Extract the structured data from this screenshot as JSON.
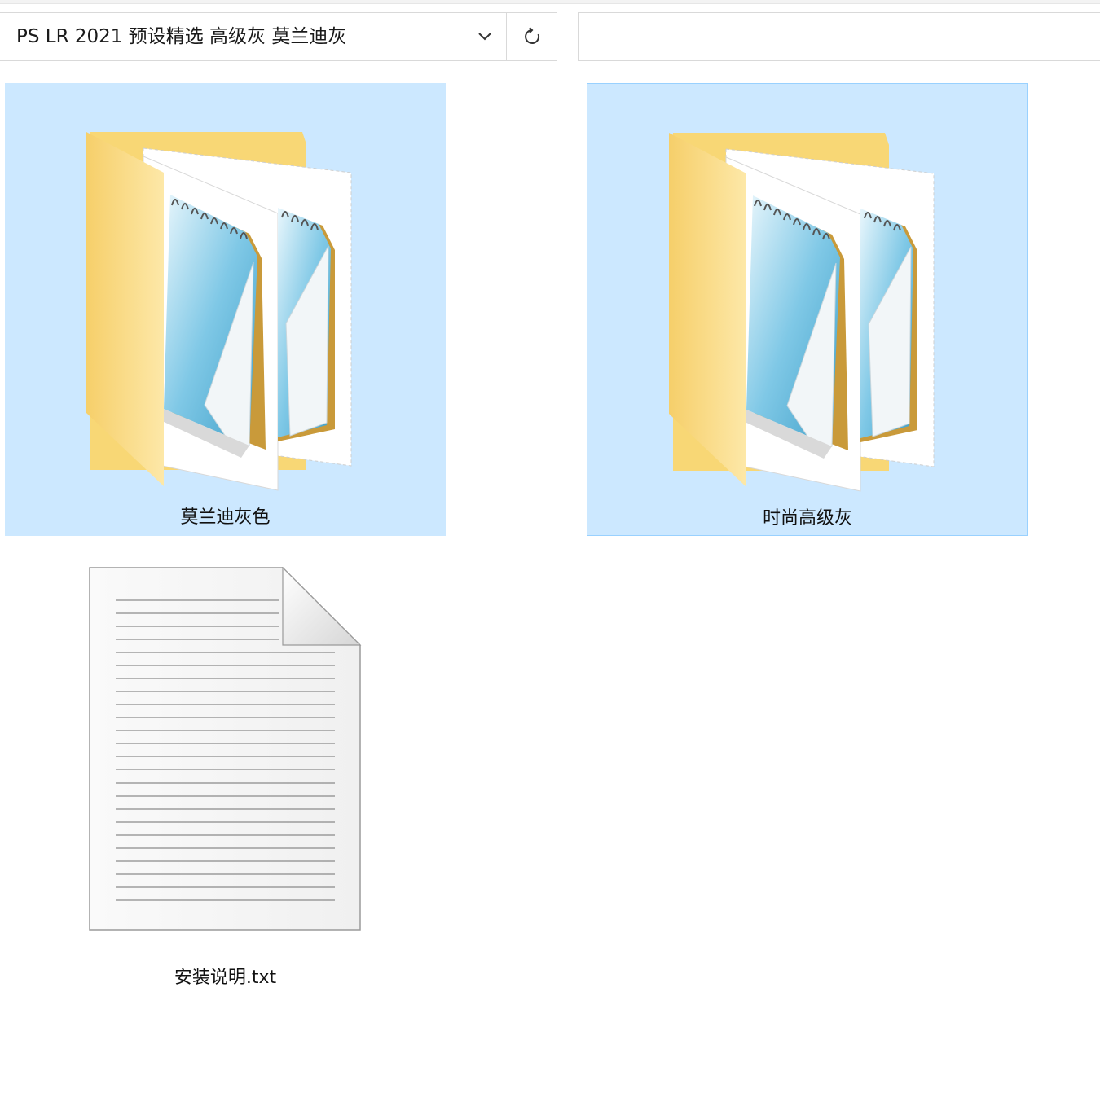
{
  "address_bar": {
    "path": "PS LR 2021 预设精选 高级灰 莫兰迪灰",
    "dropdown_icon": "chevron-down-icon",
    "refresh_icon": "refresh-icon"
  },
  "search": {
    "value": "",
    "icon": "search-icon"
  },
  "items": [
    {
      "name": "莫兰迪灰色",
      "type": "folder",
      "icon": "folder-documents-icon",
      "state": "selected"
    },
    {
      "name": "时尚高级灰",
      "type": "folder",
      "icon": "folder-documents-icon",
      "state": "selected-focused"
    },
    {
      "name": "安装说明.txt",
      "type": "text-file",
      "icon": "text-document-icon",
      "state": "normal"
    }
  ],
  "colors": {
    "selection": "#cce8ff",
    "focus_border": "#99d1ff",
    "folder_yellow": "#f8d775",
    "notepad_blue": "#5fb3d9"
  }
}
